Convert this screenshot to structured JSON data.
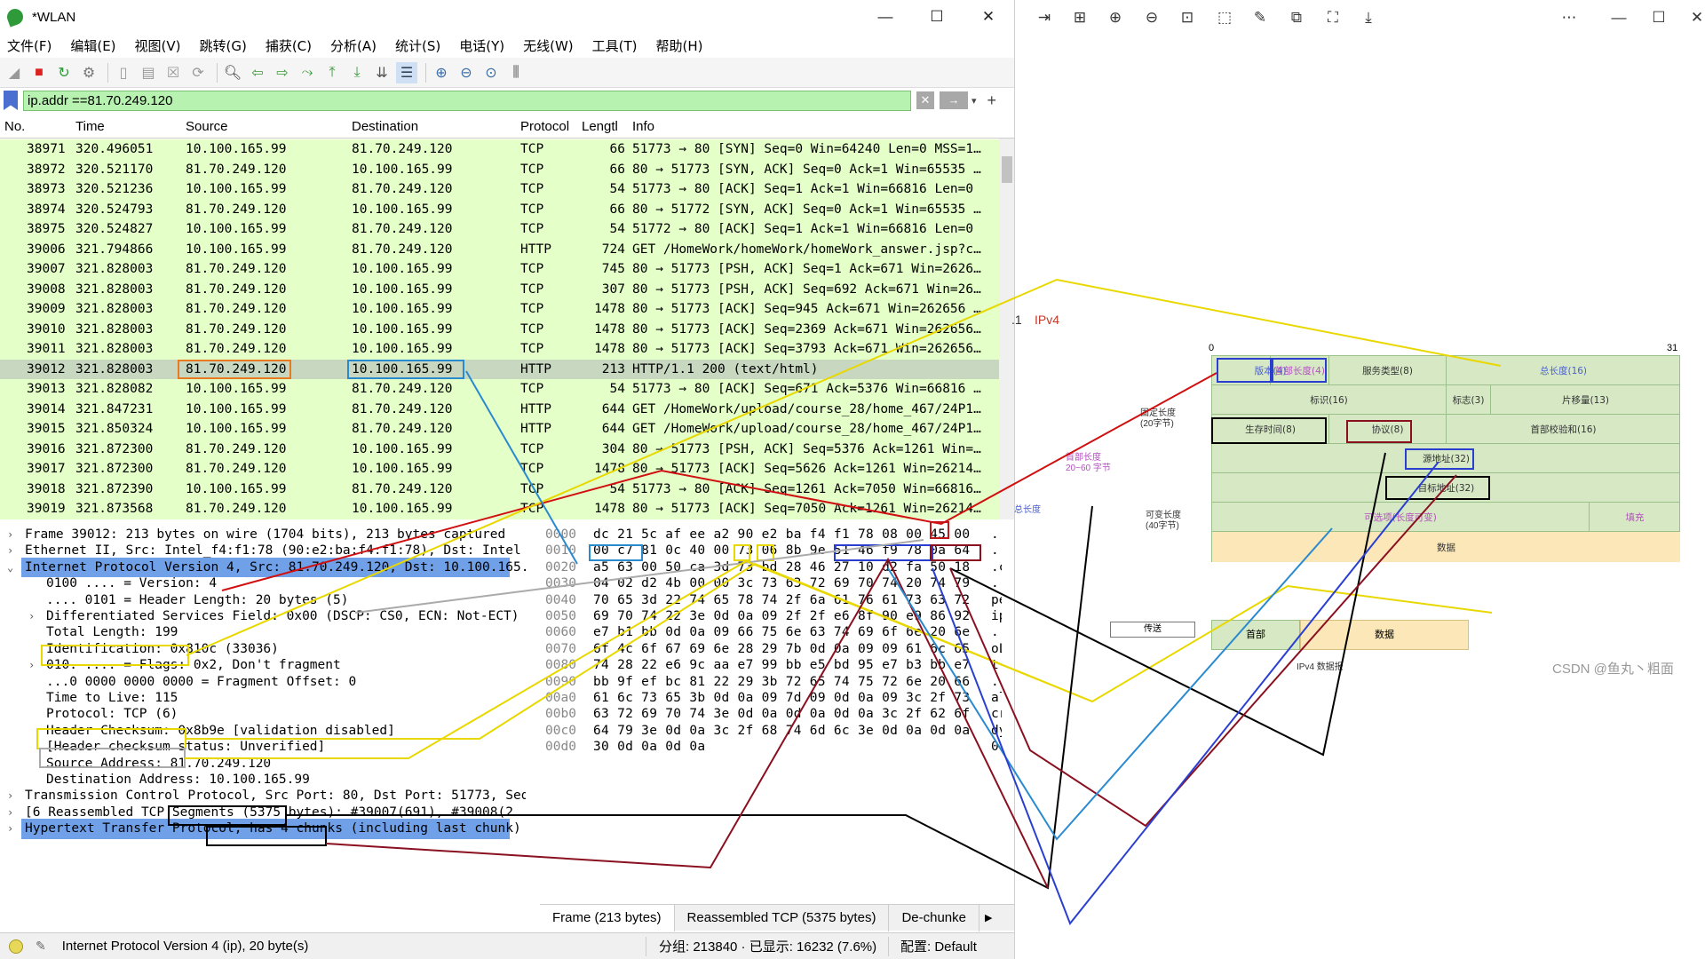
{
  "window": {
    "title": "*WLAN",
    "minimize": "—",
    "maximize": "☐",
    "close": "✕"
  },
  "menu": [
    "文件(F)",
    "编辑(E)",
    "视图(V)",
    "跳转(G)",
    "捕获(C)",
    "分析(A)",
    "统计(S)",
    "电话(Y)",
    "无线(W)",
    "工具(T)",
    "帮助(H)"
  ],
  "filter": {
    "value": "ip.addr ==81.70.249.120",
    "clear": "✕",
    "apply": "→",
    "dropdown": "▾",
    "add": "+"
  },
  "columns": [
    "No.",
    "Time",
    "Source",
    "Destination",
    "Protocol",
    "Lengtl",
    "Info"
  ],
  "packets": [
    {
      "no": "38971",
      "time": "320.496051",
      "src": "10.100.165.99",
      "dst": "81.70.249.120",
      "proto": "TCP",
      "len": "66",
      "info": "51773 → 80 [SYN] Seq=0 Win=64240 Len=0 MSS=1…"
    },
    {
      "no": "38972",
      "time": "320.521170",
      "src": "81.70.249.120",
      "dst": "10.100.165.99",
      "proto": "TCP",
      "len": "66",
      "info": "80 → 51773 [SYN, ACK] Seq=0 Ack=1 Win=65535 …"
    },
    {
      "no": "38973",
      "time": "320.521236",
      "src": "10.100.165.99",
      "dst": "81.70.249.120",
      "proto": "TCP",
      "len": "54",
      "info": "51773 → 80 [ACK] Seq=1 Ack=1 Win=66816 Len=0"
    },
    {
      "no": "38974",
      "time": "320.524793",
      "src": "81.70.249.120",
      "dst": "10.100.165.99",
      "proto": "TCP",
      "len": "66",
      "info": "80 → 51772 [SYN, ACK] Seq=0 Ack=1 Win=65535 …"
    },
    {
      "no": "38975",
      "time": "320.524827",
      "src": "10.100.165.99",
      "dst": "81.70.249.120",
      "proto": "TCP",
      "len": "54",
      "info": "51772 → 80 [ACK] Seq=1 Ack=1 Win=66816 Len=0"
    },
    {
      "no": "39006",
      "time": "321.794866",
      "src": "10.100.165.99",
      "dst": "81.70.249.120",
      "proto": "HTTP",
      "len": "724",
      "info": "GET /HomeWork/homeWork/homeWork_answer.jsp?c…"
    },
    {
      "no": "39007",
      "time": "321.828003",
      "src": "81.70.249.120",
      "dst": "10.100.165.99",
      "proto": "TCP",
      "len": "745",
      "info": "80 → 51773 [PSH, ACK] Seq=1 Ack=671 Win=2626…"
    },
    {
      "no": "39008",
      "time": "321.828003",
      "src": "81.70.249.120",
      "dst": "10.100.165.99",
      "proto": "TCP",
      "len": "307",
      "info": "80 → 51773 [PSH, ACK] Seq=692 Ack=671 Win=26…"
    },
    {
      "no": "39009",
      "time": "321.828003",
      "src": "81.70.249.120",
      "dst": "10.100.165.99",
      "proto": "TCP",
      "len": "1478",
      "info": "80 → 51773 [ACK] Seq=945 Ack=671 Win=262656 …"
    },
    {
      "no": "39010",
      "time": "321.828003",
      "src": "81.70.249.120",
      "dst": "10.100.165.99",
      "proto": "TCP",
      "len": "1478",
      "info": "80 → 51773 [ACK] Seq=2369 Ack=671 Win=262656…"
    },
    {
      "no": "39011",
      "time": "321.828003",
      "src": "81.70.249.120",
      "dst": "10.100.165.99",
      "proto": "TCP",
      "len": "1478",
      "info": "80 → 51773 [ACK] Seq=3793 Ack=671 Win=262656…"
    },
    {
      "no": "39012",
      "time": "321.828003",
      "src": "81.70.249.120",
      "dst": "10.100.165.99",
      "proto": "HTTP",
      "len": "213",
      "info": "HTTP/1.1 200   (text/html)"
    },
    {
      "no": "39013",
      "time": "321.828082",
      "src": "10.100.165.99",
      "dst": "81.70.249.120",
      "proto": "TCP",
      "len": "54",
      "info": "51773 → 80 [ACK] Seq=671 Ack=5376 Win=66816 …"
    },
    {
      "no": "39014",
      "time": "321.847231",
      "src": "10.100.165.99",
      "dst": "81.70.249.120",
      "proto": "HTTP",
      "len": "644",
      "info": "GET /HomeWork/upload/course_28/home_467/24P1…"
    },
    {
      "no": "39015",
      "time": "321.850324",
      "src": "10.100.165.99",
      "dst": "81.70.249.120",
      "proto": "HTTP",
      "len": "644",
      "info": "GET /HomeWork/upload/course_28/home_467/24P1…"
    },
    {
      "no": "39016",
      "time": "321.872300",
      "src": "81.70.249.120",
      "dst": "10.100.165.99",
      "proto": "TCP",
      "len": "304",
      "info": "80 → 51773 [PSH, ACK] Seq=5376 Ack=1261 Win=…"
    },
    {
      "no": "39017",
      "time": "321.872300",
      "src": "81.70.249.120",
      "dst": "10.100.165.99",
      "proto": "TCP",
      "len": "1478",
      "info": "80 → 51773 [ACK] Seq=5626 Ack=1261 Win=26214…"
    },
    {
      "no": "39018",
      "time": "321.872390",
      "src": "10.100.165.99",
      "dst": "81.70.249.120",
      "proto": "TCP",
      "len": "54",
      "info": "51773 → 80 [ACK] Seq=1261 Ack=7050 Win=66816…"
    },
    {
      "no": "39019",
      "time": "321.873568",
      "src": "81.70.249.120",
      "dst": "10.100.165.99",
      "proto": "TCP",
      "len": "1478",
      "info": "80 → 51773 [ACK] Seq=7050 Ack=1261 Win=26214…"
    }
  ],
  "details": [
    {
      "indent": 0,
      "arrow": "›",
      "text": "Frame 39012: 213 bytes on wire (1704 bits), 213 bytes captured"
    },
    {
      "indent": 0,
      "arrow": "›",
      "text": "Ethernet II, Src: Intel_f4:f1:78 (90:e2:ba:f4:f1:78), Dst: Intel"
    },
    {
      "indent": 0,
      "arrow": "⌄",
      "text": "Internet Protocol Version 4, Src: 81.70.249.120, Dst: 10.100.165.99",
      "hl": true
    },
    {
      "indent": 1,
      "arrow": "",
      "text": "0100 .... = Version: 4"
    },
    {
      "indent": 1,
      "arrow": "",
      "text": ".... 0101 = Header Length: 20 bytes (5)"
    },
    {
      "indent": 1,
      "arrow": "›",
      "text": "Differentiated Services Field: 0x00 (DSCP: CS0, ECN: Not-ECT)"
    },
    {
      "indent": 1,
      "arrow": "",
      "text": "Total Length: 199"
    },
    {
      "indent": 1,
      "arrow": "",
      "text": "Identification: 0x810c (33036)"
    },
    {
      "indent": 1,
      "arrow": "›",
      "text": "010. .... = Flags: 0x2, Don't fragment"
    },
    {
      "indent": 1,
      "arrow": "",
      "text": "...0 0000 0000 0000 = Fragment Offset: 0"
    },
    {
      "indent": 1,
      "arrow": "",
      "text": "Time to Live: 115"
    },
    {
      "indent": 1,
      "arrow": "",
      "text": "Protocol: TCP (6)"
    },
    {
      "indent": 1,
      "arrow": "",
      "text": "Header Checksum: 0x8b9e [validation disabled]"
    },
    {
      "indent": 1,
      "arrow": "",
      "text": "[Header checksum status: Unverified]"
    },
    {
      "indent": 1,
      "arrow": "",
      "text": "Source Address: 81.70.249.120"
    },
    {
      "indent": 1,
      "arrow": "",
      "text": "Destination Address: 10.100.165.99"
    },
    {
      "indent": 0,
      "arrow": "›",
      "text": "Transmission Control Protocol, Src Port: 80, Dst Port: 51773, Seq"
    },
    {
      "indent": 0,
      "arrow": "›",
      "text": "[6 Reassembled TCP Segments (5375 bytes): #39007(691), #39008(2"
    },
    {
      "indent": 0,
      "arrow": "›",
      "text": "Hypertext Transfer Protocol, has 4 chunks (including last chunk)",
      "hl": true
    }
  ],
  "bytes": [
    {
      "off": "0000",
      "hex": "dc 21 5c af ee a2 90 e2  ba f4 f1 78 08 00 45 00",
      "ascii": ".!"
    },
    {
      "off": "0010",
      "hex": "00 c7 81 0c 40 00 73 06  8b 9e 51 46 f9 78 0a 64",
      "ascii": ".."
    },
    {
      "off": "0020",
      "hex": "a5 63 00 50 ca 3d 73 bd  28 46 27 10 d2 fa 50 18",
      "ascii": ".c"
    },
    {
      "off": "0030",
      "hex": "04 02 d2 4b 00 00 3c 73  63 72 69 70 74 20 74 79",
      "ascii": ".."
    },
    {
      "off": "0040",
      "hex": "70 65 3d 22 74 65 78 74  2f 6a 61 76 61 73 63 72",
      "ascii": "pe"
    },
    {
      "off": "0050",
      "hex": "69 70 74 22 3e 0d 0a 09  2f 2f e6 8f 90 e9 86 92",
      "ascii": "ip"
    },
    {
      "off": "0060",
      "hex": "e7 b1 bb 0d 0a 09 66 75  6e 63 74 69 6f 6e 20 6e",
      "ascii": ".."
    },
    {
      "off": "0070",
      "hex": "6f 4c 6f 67 69 6e 28 29  7b 0d 0a 09 09 61 6c 65",
      "ascii": "oL"
    },
    {
      "off": "0080",
      "hex": "74 28 22 e6 9c aa e7 99  bb e5 bd 95 e7 b3 bb e7",
      "ascii": "t("
    },
    {
      "off": "0090",
      "hex": "bb 9f ef bc 81 22 29 3b  72 65 74 75 72 6e 20 66",
      "ascii": ".."
    },
    {
      "off": "00a0",
      "hex": "61 6c 73 65 3b 0d 0a 09  7d 09 0d 0a 09 3c 2f 73",
      "ascii": "al"
    },
    {
      "off": "00b0",
      "hex": "63 72 69 70 74 3e 0d 0a  0d 0a 0d 0a 3c 2f 62 6f",
      "ascii": "cr"
    },
    {
      "off": "00c0",
      "hex": "64 79 3e 0d 0a 3c 2f 68  74 6d 6c 3e 0d 0a 0d 0a",
      "ascii": "dy"
    },
    {
      "off": "00d0",
      "hex": "30 0d 0a 0d 0a",
      "ascii": "0."
    }
  ],
  "byte_tabs": [
    "Frame (213 bytes)",
    "Reassembled TCP (5375 bytes)",
    "De-chunke"
  ],
  "status": {
    "main": "Internet Protocol Version 4 (ip), 20 byte(s)",
    "packets": "分组: 213840 · 已显示: 16232 (7.6%)",
    "profile": "配置: Default"
  },
  "viewer_icons": [
    "arrow-right-icon",
    "grid-icon",
    "zoom-in-icon",
    "zoom-out-icon",
    "fit-icon",
    "crop-icon",
    "edit-icon",
    "copy-icon",
    "scan-icon",
    "download-icon",
    "more-icon",
    "minimize-icon",
    "maximize-icon",
    "close-icon"
  ],
  "diagram": {
    "section_num": ".1",
    "section_title": "IPv4",
    "bit0": "0",
    "bit31": "31",
    "fixed_label": "固定长度\n(20字节)",
    "header_len_label": "首部长度\n20~60 字节",
    "var_label": "可变长度\n(40字节)",
    "total_label": "总长度",
    "version": "版本(4)",
    "ihl": "首部长度(4)",
    "tos": "服务类型(8)",
    "total_len": "总长度(16)",
    "ident": "标识(16)",
    "flags": "标志(3)",
    "frag": "片移量(13)",
    "ttl": "生存时间(8)",
    "protocol": "协议(8)",
    "checksum": "首部校验和(16)",
    "src": "源地址(32)",
    "dst": "目标地址(32)",
    "options": "可选项(长度可变)",
    "padding": "填充",
    "data": "数据",
    "send": "传送",
    "hdr": "首部",
    "data2": "数据",
    "datagram": "IPv4 数据报"
  },
  "watermark": "CSDN @鱼丸丶粗面"
}
